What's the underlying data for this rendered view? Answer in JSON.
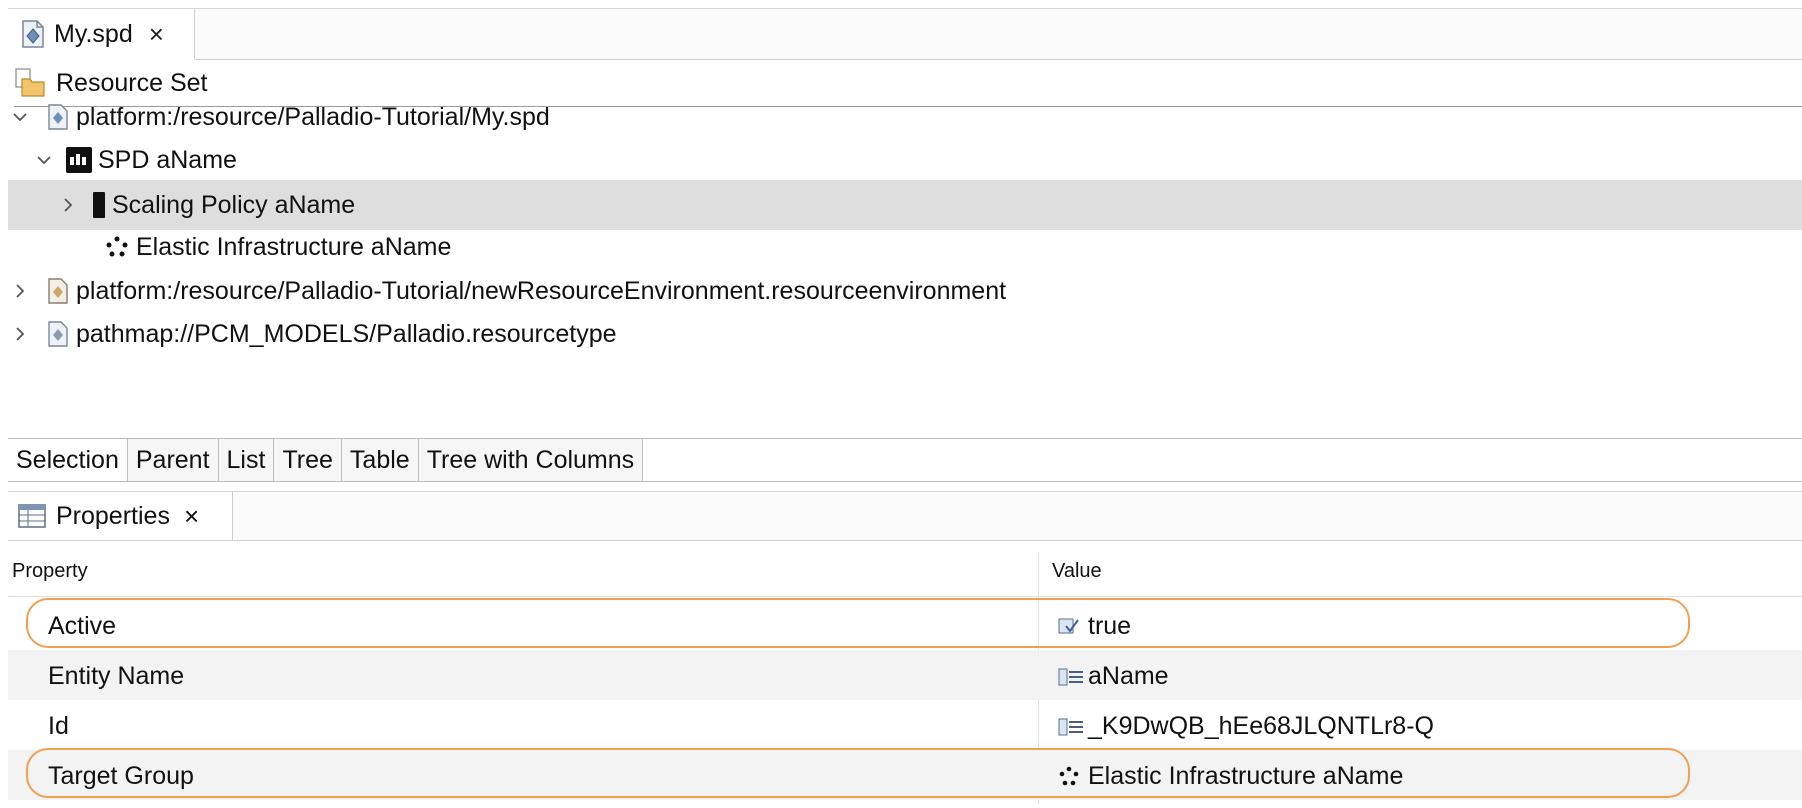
{
  "editor": {
    "tab_label": "My.spd",
    "tab_close": "×",
    "root_label": "Resource Set"
  },
  "tree": {
    "items": [
      {
        "label": "platform:/resource/Palladio-Tutorial/My.spd",
        "expanded": true,
        "icon": "spd-file-icon"
      },
      {
        "label": "SPD aName",
        "expanded": true,
        "icon": "spd-icon"
      },
      {
        "label": "Scaling Policy aName",
        "expanded": false,
        "icon": "scaling-policy-icon",
        "selected": true
      },
      {
        "label": "Elastic Infrastructure aName",
        "icon": "elastic-infrastructure-icon"
      },
      {
        "label": "platform:/resource/Palladio-Tutorial/newResourceEnvironment.resourceenvironment",
        "expanded": false,
        "icon": "resource-environment-file-icon"
      },
      {
        "label": "pathmap://PCM_MODELS/Palladio.resourcetype",
        "expanded": false,
        "icon": "resourcetype-file-icon"
      }
    ]
  },
  "view_tabs": [
    "Selection",
    "Parent",
    "List",
    "Tree",
    "Table",
    "Tree with Columns"
  ],
  "properties": {
    "tab_label": "Properties",
    "tab_close": "×",
    "col_property": "Property",
    "col_value": "Value",
    "rows": [
      {
        "name": "Active",
        "value": "true",
        "icon": "boolean-value-icon",
        "highlighted": true
      },
      {
        "name": "Entity Name",
        "value": "aName",
        "icon": "text-value-icon"
      },
      {
        "name": "Id",
        "value": "_K9DwQB_hEe68JLQNTLr8-Q",
        "icon": "text-value-icon"
      },
      {
        "name": "Target Group",
        "value": "Elastic Infrastructure aName",
        "icon": "elastic-infrastructure-icon",
        "highlighted": true
      }
    ]
  },
  "colors": {
    "highlight": "#f0a050",
    "selected_row": "#dedede"
  }
}
